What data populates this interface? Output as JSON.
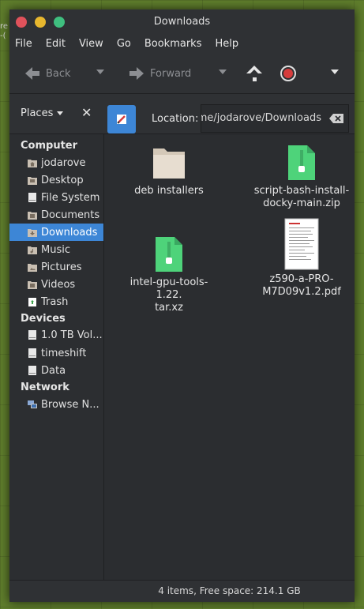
{
  "desktop": {
    "text1": "re",
    "text2": "-("
  },
  "window": {
    "title": "Downloads"
  },
  "menubar": [
    "File",
    "Edit",
    "View",
    "Go",
    "Bookmarks",
    "Help"
  ],
  "toolbar": {
    "back": "Back",
    "forward": "Forward"
  },
  "locationbar": {
    "places": "Places",
    "location_label": "Location:",
    "path": "me/jodarove/Downloads"
  },
  "sidebar": {
    "sections": [
      {
        "title": "Computer",
        "items": [
          "jodarove",
          "Desktop",
          "File System",
          "Documents",
          "Downloads",
          "Music",
          "Pictures",
          "Videos",
          "Trash"
        ]
      },
      {
        "title": "Devices",
        "items": [
          "1.0 TB Vol...",
          "timeshift",
          "Data"
        ]
      },
      {
        "title": "Network",
        "items": [
          "Browse N..."
        ]
      }
    ],
    "active": "Downloads"
  },
  "files": [
    {
      "name_line1": "deb installers",
      "name_line2": "",
      "icon": "folder-icon"
    },
    {
      "name_line1": "script-bash-install-",
      "name_line2": "docky-main.zip",
      "icon": "archive-icon"
    },
    {
      "name_line1": "intel-gpu-tools-1.22.",
      "name_line2": "tar.xz",
      "icon": "archive-icon"
    },
    {
      "name_line1": "z590-a-PRO-",
      "name_line2": "M7D09v1.2.pdf",
      "icon": "pdf-icon"
    }
  ],
  "status": "4 items, Free space: 214.1 GB",
  "colors": {
    "accent": "#3d86d6",
    "archive": "#4ed37a",
    "folder": "#e7ddd0"
  }
}
